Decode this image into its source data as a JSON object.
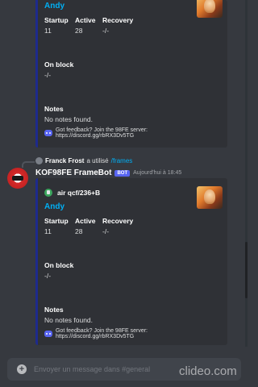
{
  "colors": {
    "background": "#36393f",
    "embed": "#2f3136",
    "accent": "#1e2a8c",
    "link": "#00aff4",
    "bot_tag": "#5865f2"
  },
  "embed1": {
    "character": "Andy",
    "fields": {
      "startup_label": "Startup",
      "startup_value": "11",
      "active_label": "Active",
      "active_value": "28",
      "recovery_label": "Recovery",
      "recovery_value": "-/-",
      "onblock_label": "On block",
      "onblock_value": "-/-",
      "notes_label": "Notes",
      "notes_value": "No notes found."
    },
    "footer": "Got feedback? Join the 98FE server: https://discord.gg/rbRX3Dv5TG"
  },
  "reply": {
    "author": "Franck Frost",
    "text": "a utilisé",
    "command": "/frames"
  },
  "message": {
    "bot_name": "KOF98FE FrameBot",
    "bot_tag": "BOT",
    "timestamp": "Aujourd'hui à 18:45"
  },
  "embed2": {
    "move": "air qcf/236+B",
    "character": "Andy",
    "fields": {
      "startup_label": "Startup",
      "startup_value": "11",
      "active_label": "Active",
      "active_value": "28",
      "recovery_label": "Recovery",
      "recovery_value": "-/-",
      "onblock_label": "On block",
      "onblock_value": "-/-",
      "notes_label": "Notes",
      "notes_value": "No notes found."
    },
    "footer": "Got feedback? Join the 98FE server: https://discord.gg/rbRX3Dv5TG"
  },
  "input": {
    "placeholder": "Envoyer un message dans #general"
  },
  "watermark": "clideo.com",
  "icons": [
    "discord-icon",
    "plus-icon",
    "avatar",
    "move-icon"
  ]
}
